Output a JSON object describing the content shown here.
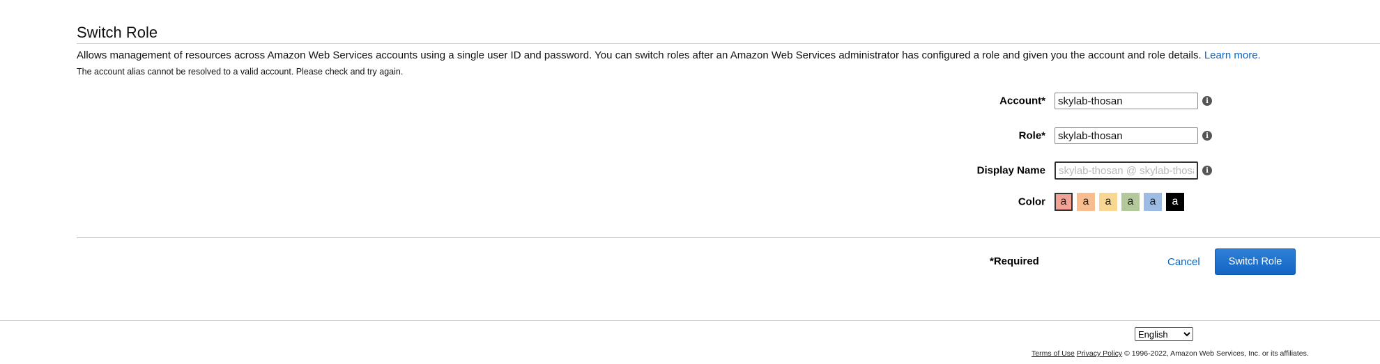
{
  "page": {
    "title": "Switch Role",
    "description": "Allows management of resources across Amazon Web Services accounts using a single user ID and password. You can switch roles after an Amazon Web Services administrator has configured a role and given you the account and role details.",
    "learn_more_label": "Learn more.",
    "error_message": "The account alias cannot be resolved to a valid account. Please check and try again."
  },
  "form": {
    "account": {
      "label": "Account*",
      "value": "skylab-thosan",
      "info_icon": "info-icon"
    },
    "role": {
      "label": "Role*",
      "value": "skylab-thosan",
      "info_icon": "info-icon"
    },
    "display_name": {
      "label": "Display Name",
      "value": "",
      "placeholder": "skylab-thosan @ skylab-thosan",
      "info_icon": "info-icon"
    },
    "color": {
      "label": "Color",
      "selected_index": 0,
      "swatches": [
        {
          "letter": "a",
          "color": "#f2a395",
          "text_color": "#222222"
        },
        {
          "letter": "a",
          "color": "#f8bd8f",
          "text_color": "#222222"
        },
        {
          "letter": "a",
          "color": "#f8d792",
          "text_color": "#222222"
        },
        {
          "letter": "a",
          "color": "#b3c99b",
          "text_color": "#222222"
        },
        {
          "letter": "a",
          "color": "#9dbbe3",
          "text_color": "#222222"
        },
        {
          "letter": "a",
          "color": "#000000",
          "text_color": "#ffffff"
        }
      ]
    }
  },
  "actions": {
    "required_note": "*Required",
    "cancel_label": "Cancel",
    "submit_label": "Switch Role",
    "primary_color": "#1a6fcc",
    "link_color": "#0b63c1"
  },
  "footer": {
    "language": "English",
    "terms_label": "Terms of Use",
    "privacy_label": "Privacy Policy",
    "copyright": "© 1996-2022, Amazon Web Services, Inc. or its affiliates."
  }
}
